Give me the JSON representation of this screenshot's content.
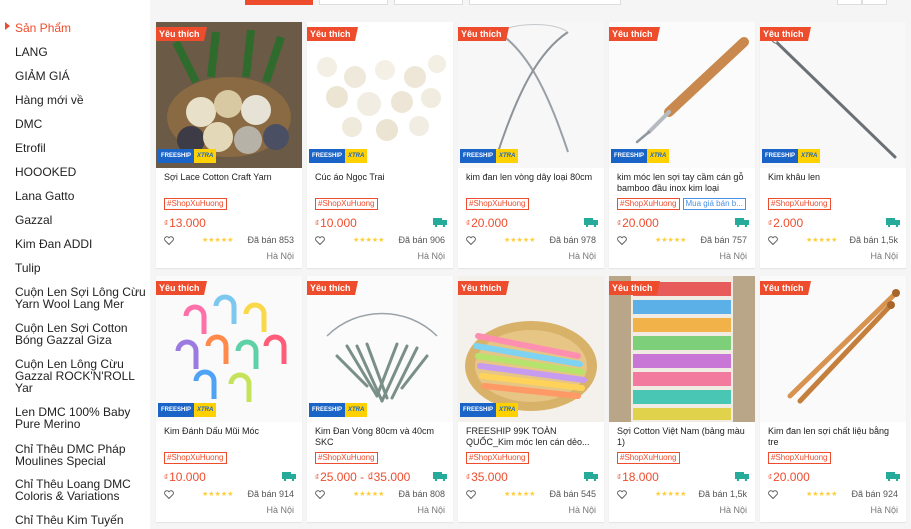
{
  "sidebar": {
    "items": [
      {
        "label": "Sản Phẩm",
        "active": true
      },
      {
        "label": "LANG"
      },
      {
        "label": "GIẢM GIÁ"
      },
      {
        "label": "Hàng mới về"
      },
      {
        "label": "DMC"
      },
      {
        "label": "Etrofil"
      },
      {
        "label": "HOOOKED"
      },
      {
        "label": "Lana Gatto"
      },
      {
        "label": "Gazzal"
      },
      {
        "label": "Kim Đan ADDI"
      },
      {
        "label": "Tulip"
      },
      {
        "label": "Cuộn Len Sợi Lông Cừu Yarn Wool Lang Mer"
      },
      {
        "label": "Cuộn Len Sợi Cotton Bóng Gazzal Giza"
      },
      {
        "label": "Cuộn Len Lông Cừu Gazzal ROCK'N'ROLL Yar"
      },
      {
        "label": "Len DMC 100% Baby Pure Merino"
      },
      {
        "label": "Chỉ Thêu DMC Pháp Moulines Special"
      },
      {
        "label": "Chỉ Thêu Loang DMC Coloris & Variations"
      },
      {
        "label": "Chỉ Thêu Kim Tuyến"
      }
    ]
  },
  "common": {
    "badge": "Yêu thích",
    "freeship_a": "FREESHIP",
    "freeship_b": "XTRA",
    "shop_tag": "#ShopXuHuong",
    "currency": "₫",
    "stars": "★★★★★"
  },
  "products": [
    {
      "name": "Sợi Lace Cotton Craft Yarn",
      "price": "13.000",
      "sold": "Đã bán 853",
      "location": "Hà Nội",
      "extra_tag": "",
      "icon": "yarn-balls"
    },
    {
      "name": "Cúc áo Ngọc Trai",
      "price": "10.000",
      "sold": "Đã bán 906",
      "location": "Hà Nội",
      "extra_tag": "",
      "icon": "pearls"
    },
    {
      "name": "kim đan len vòng dây loại 80cm",
      "price": "20.000",
      "sold": "Đã bán 978",
      "location": "Hà Nội",
      "extra_tag": "",
      "icon": "circular-needle"
    },
    {
      "name": "kim móc len sợi tay cầm cán gỗ bamboo đầu inox kim loại",
      "price": "20.000",
      "sold": "Đã bán 757",
      "location": "Hà Nội",
      "extra_tag": "Mua giá bán b...",
      "icon": "crochet-hook"
    },
    {
      "name": "Kim khâu len",
      "price": "2.000",
      "sold": "Đã bán 1,5k",
      "location": "Hà Nội",
      "extra_tag": "",
      "icon": "sewing-needle"
    },
    {
      "name": "Kim Đánh Dấu Mũi Móc",
      "price": "10.000",
      "sold": "Đã bán 914",
      "location": "Hà Nội",
      "extra_tag": "",
      "icon": "stitch-markers"
    },
    {
      "name": "Kim Đan Vòng 80cm và 40cm SKC",
      "price": "25.000 - ₫35.000",
      "sold": "Đã bán 808",
      "location": "Hà Nội",
      "extra_tag": "",
      "icon": "circular-needles-set"
    },
    {
      "name": "FREESHIP 99K TOÀN QUỐC_Kim móc len cán dẻo...",
      "price": "35.000",
      "sold": "Đã bán 545",
      "location": "Hà Nội",
      "extra_tag": "",
      "icon": "crochet-set"
    },
    {
      "name": "Sợi Cotton Việt Nam (bảng màu 1)",
      "price": "18.000",
      "sold": "Đã bán 1,5k",
      "location": "Hà Nội",
      "extra_tag": "",
      "icon": "thread-shelf"
    },
    {
      "name": "Kim đan len sợi chất liệu bằng tre",
      "price": "20.000",
      "sold": "Đã bán 924",
      "location": "Hà Nội",
      "extra_tag": "",
      "icon": "bamboo-needles"
    }
  ],
  "colors": {
    "accent": "#ee4d2d",
    "freeship_blue": "#1a63c7",
    "freeship_yellow": "#ffd100",
    "star": "#ffce3d",
    "truck_green": "#26aa99"
  }
}
